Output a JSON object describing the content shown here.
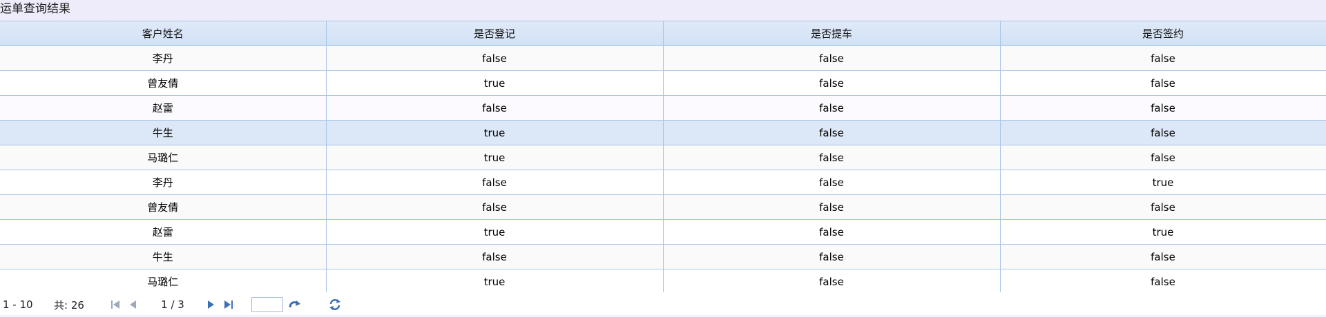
{
  "panel": {
    "title": "运单查询结果"
  },
  "table": {
    "columns": [
      "客户姓名",
      "是否登记",
      "是否提车",
      "是否签约"
    ],
    "rows": [
      [
        "李丹",
        "false",
        "false",
        "false"
      ],
      [
        "曾友倩",
        "true",
        "false",
        "false"
      ],
      [
        "赵雷",
        "false",
        "false",
        "false"
      ],
      [
        "牛生",
        "true",
        "false",
        "false"
      ],
      [
        "马璐仁",
        "true",
        "false",
        "false"
      ],
      [
        "李丹",
        "false",
        "false",
        "true"
      ],
      [
        "曾友倩",
        "false",
        "false",
        "false"
      ],
      [
        "赵雷",
        "true",
        "false",
        "true"
      ],
      [
        "牛生",
        "false",
        "false",
        "false"
      ],
      [
        "马璐仁",
        "true",
        "false",
        "false"
      ]
    ],
    "selected_row": 3
  },
  "pager": {
    "range": "1 - 10",
    "total": "共: 26",
    "page_info": "1 / 3",
    "page_input_value": ""
  },
  "colors": {
    "header_bg": "#d7e4f6",
    "border": "#a7c4e8",
    "selected_row": "#dce7f7",
    "title_bg": "#eeecfa",
    "icon_blue": "#3d6fb5"
  }
}
